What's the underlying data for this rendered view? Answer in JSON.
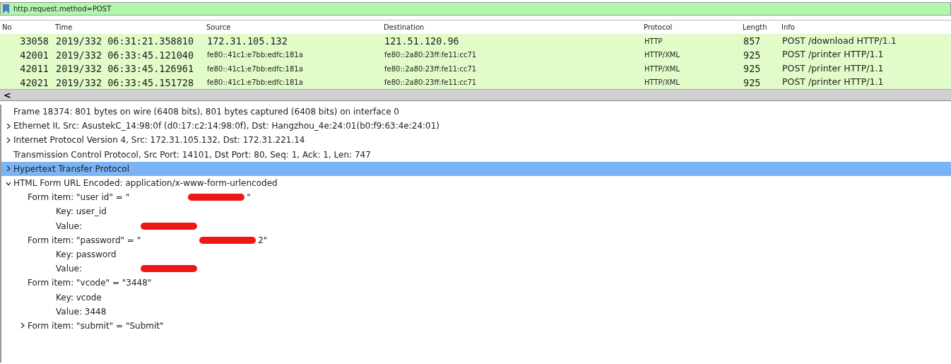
{
  "filter": {
    "value": "http.request.method=POST"
  },
  "packet_list": {
    "columns": [
      "No",
      "Time",
      "Source",
      "Destination",
      "Protocol",
      "Length",
      "Info"
    ],
    "rows": [
      {
        "cells": [
          "33058",
          "2019/332 06:31:21.358810",
          "172.31.105.132",
          "121.51.120.96",
          "HTTP",
          "857",
          "POST /download HTTP/1.1"
        ]
      },
      {
        "cells": [
          "42001",
          "2019/332 06:33:45.121040",
          "fe80::41c1:e7bb:edfc:181a",
          "fe80::2a80:23ff:fe11:cc71",
          "HTTP/XML",
          "925",
          "POST /printer HTTP/1.1"
        ]
      },
      {
        "cells": [
          "42011",
          "2019/332 06:33:45.126961",
          "fe80::41c1:e7bb:edfc:181a",
          "fe80::2a80:23ff:fe11:cc71",
          "HTTP/XML",
          "925",
          "POST /printer HTTP/1.1"
        ]
      },
      {
        "cells": [
          "42021",
          "2019/332 06:33:45.151728",
          "fe80::41c1:e7bb:edfc:181a",
          "fe80::2a80:23ff:fe11:cc71",
          "HTTP/XML",
          "925",
          "POST /printer HTTP/1.1"
        ]
      }
    ]
  },
  "scrollbar": {
    "left_arrow": "<"
  },
  "details": [
    {
      "text": "Frame 18374: 801 bytes on wire (6408 bits), 801 bytes captured (6408 bits) on interface 0",
      "selected": false
    },
    {
      "text": "Ethernet II,  Src: AsustekC_14:98:0f (d0:17:c2:14:98:0f), Dst: Hangzhou_4e:24:01(b0:f9:63:4e:24:01)",
      "expanded": false,
      "selected": false
    },
    {
      "text": "Internet Protocol Version 4,  Src: 172.31.105.132, Dst: 172.31.221.14",
      "expanded": false,
      "selected": false
    },
    {
      "text": "Transmission Control Protocol, Src Port: 14101, Dst Port: 80, Seq: 1, Ack: 1, Len: 747",
      "selected": false
    },
    {
      "text": "Hypertext Transfer Protocol",
      "expanded": false,
      "selected": true
    },
    {
      "text": "HTML Form URL Encoded: application/x-www-form-urlencoded",
      "expanded": true,
      "selected": false,
      "children": [
        {
          "text": "Form item: \"user id\" = \"",
          "redacted": true,
          "suffix": "\"",
          "selected": false,
          "children": [
            {
              "text": "Key: user_id",
              "selected": false
            },
            {
              "text": "Value:",
              "redacted": true,
              "selected": false
            }
          ]
        },
        {
          "text": "Form item: \"password\" = \"",
          "redacted": true,
          "suffix": "2\"",
          "selected": false,
          "children": [
            {
              "text": "Key: password",
              "selected": false
            },
            {
              "text": "Value:",
              "redacted": true,
              "selected": false
            }
          ]
        },
        {
          "text": "Form item: \"vcode\" = \"3448\"",
          "selected": false,
          "children": [
            {
              "text": "Key: vcode",
              "selected": false
            },
            {
              "text": "Value: 3448",
              "selected": false
            }
          ]
        },
        {
          "text": "Form item:  \"submit\" = \"Submit\"",
          "expanded": false,
          "selected": false
        }
      ]
    }
  ]
}
